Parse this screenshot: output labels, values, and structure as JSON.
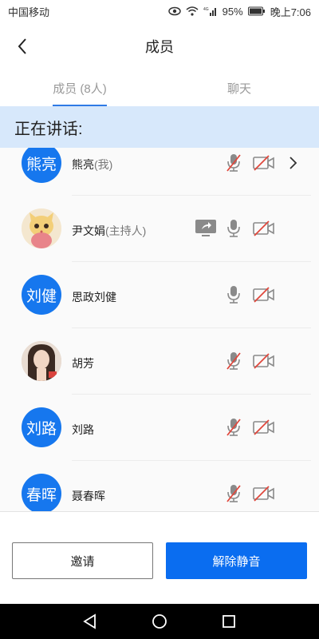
{
  "status_bar": {
    "carrier": "中国移动",
    "network": "4G",
    "battery": "95%",
    "time": "晚上7:06"
  },
  "header": {
    "title": "成员",
    "back_icon": "chevron-left-icon"
  },
  "tabs": [
    {
      "label": "成员 (8人)",
      "active": true
    },
    {
      "label": "聊天",
      "active": false
    }
  ],
  "speaking_banner": "正在讲话:",
  "members": [
    {
      "avatar_text": "熊亮",
      "avatar_type": "text",
      "name": "熊亮",
      "role": "(我)",
      "share_screen": false,
      "mic_muted": true,
      "camera_off": true,
      "has_chevron": true
    },
    {
      "avatar_text": "",
      "avatar_type": "image-cartoon",
      "name": "尹文娟",
      "role": "(主持人)",
      "share_screen": true,
      "mic_muted": false,
      "camera_off": true,
      "has_chevron": false
    },
    {
      "avatar_text": "刘健",
      "avatar_type": "text",
      "name": "思政刘健",
      "role": "",
      "share_screen": false,
      "mic_muted": false,
      "camera_off": true,
      "has_chevron": false
    },
    {
      "avatar_text": "",
      "avatar_type": "image-photo",
      "name": "胡芳",
      "role": "",
      "share_screen": false,
      "mic_muted": true,
      "camera_off": true,
      "has_chevron": false
    },
    {
      "avatar_text": "刘路",
      "avatar_type": "text",
      "name": "刘路",
      "role": "",
      "share_screen": false,
      "mic_muted": true,
      "camera_off": true,
      "has_chevron": false
    },
    {
      "avatar_text": "春晖",
      "avatar_type": "text",
      "name": "聂春晖",
      "role": "",
      "share_screen": false,
      "mic_muted": true,
      "camera_off": true,
      "has_chevron": false
    }
  ],
  "buttons": {
    "invite": "邀请",
    "unmute": "解除静音"
  },
  "colors": {
    "accent_blue": "#0a6df0",
    "avatar_blue": "#1677ee",
    "banner_bg": "#d7e8fb",
    "muted_red": "#e0473c",
    "icon_gray": "#8a8a8a"
  }
}
